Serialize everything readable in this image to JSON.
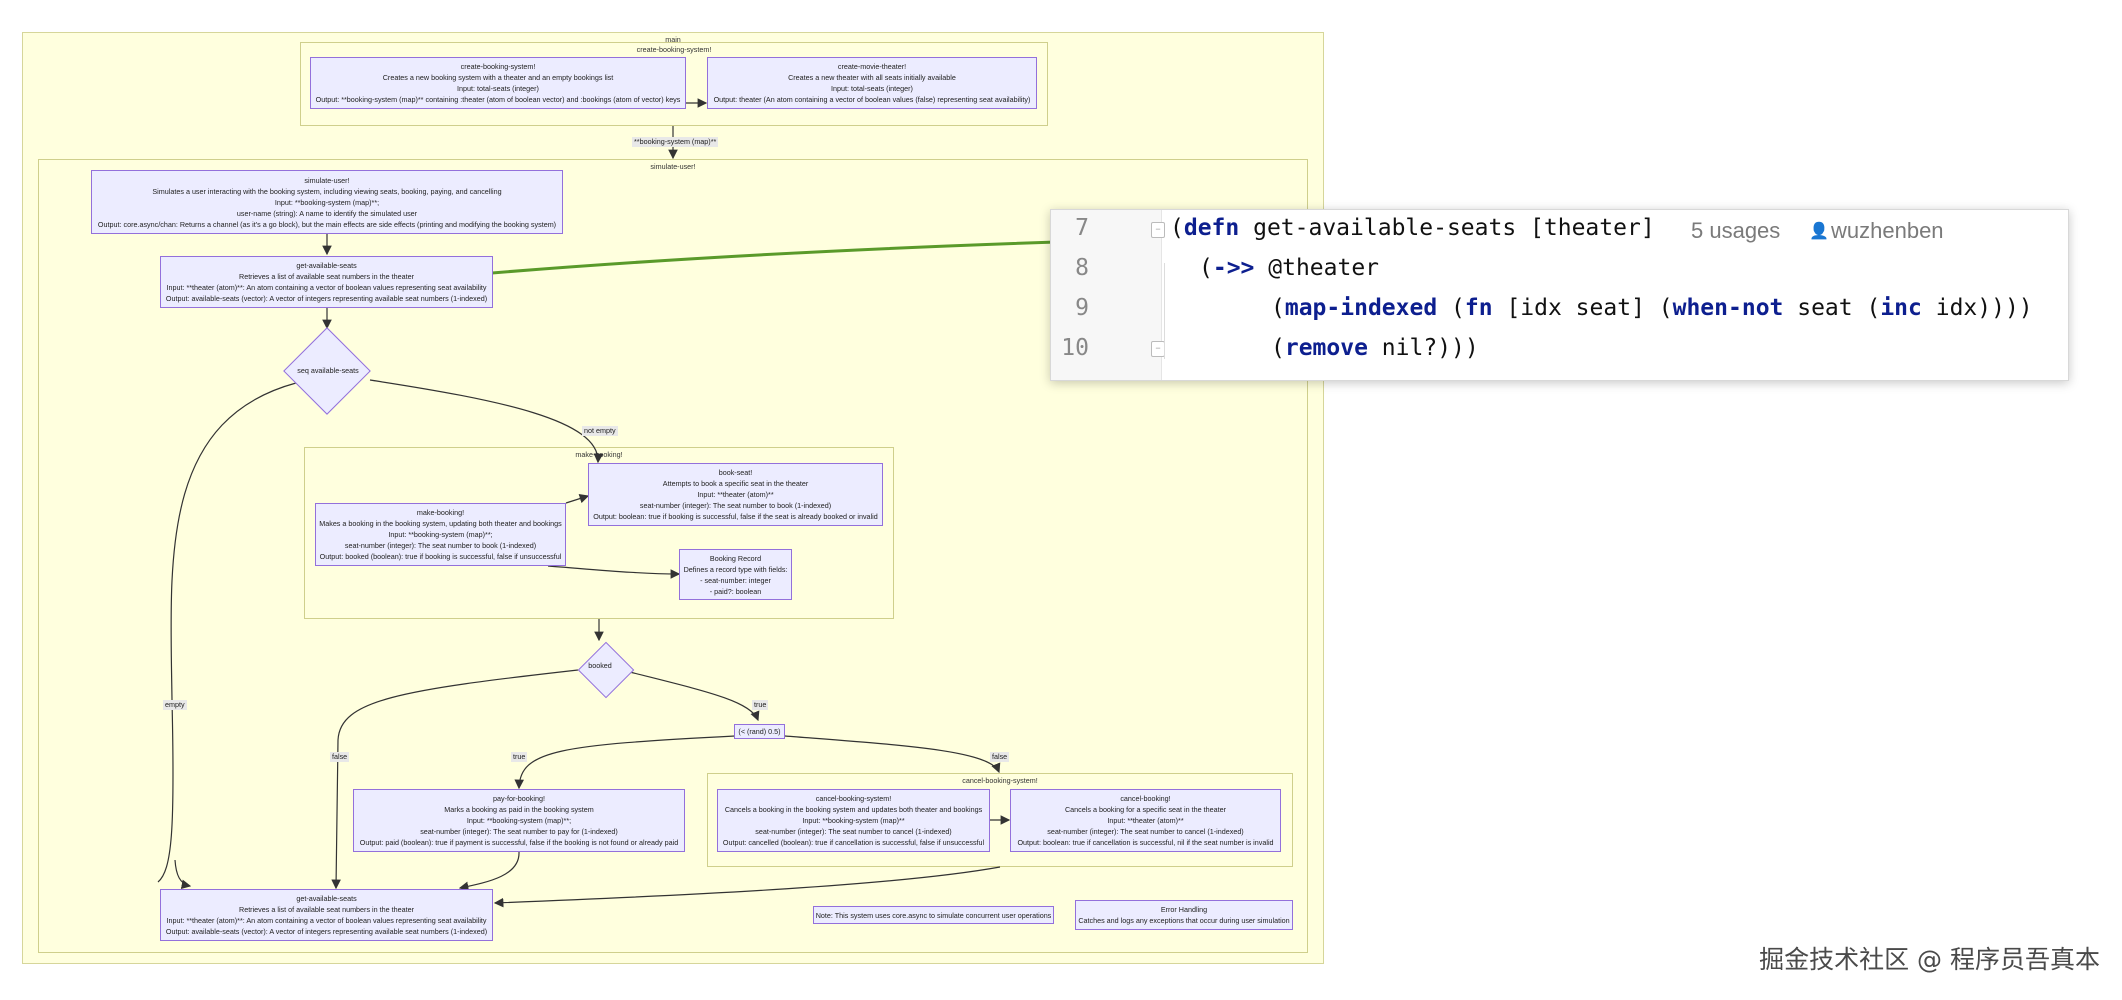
{
  "diagram": {
    "clusters": {
      "main": "main",
      "create_booking_system": "create-booking-system!",
      "simulate_user": "simulate-user!",
      "make_booking": "make-booking!",
      "cancel_booking_system": "cancel-booking-system!"
    },
    "nodes": {
      "create_booking_system": [
        "create-booking-system!",
        "Creates a new booking system with a theater and an empty bookings list",
        "Input: total-seats (integer)",
        "Output: **booking-system (map)** containing :theater (atom of boolean vector) and :bookings (atom of vector) keys"
      ],
      "create_movie_theater": [
        "create-movie-theater!",
        "Creates a new theater with all seats initially available",
        "Input: total-seats (integer)",
        "Output: theater (An atom containing a vector of boolean values (false) representing seat availability)"
      ],
      "simulate_user": [
        "simulate-user!",
        "Simulates a user interacting with the booking system, including viewing seats, booking, paying, and cancelling",
        "Input: **booking-system (map)**;",
        "user-name (string): A name to identify the simulated user",
        "Output: core.async/chan: Returns a channel (as it's a go block), but the main effects are side effects (printing and modifying the booking system)"
      ],
      "get_available_seats_top": [
        "get-available-seats",
        "Retrieves a list of available seat numbers in the theater",
        "Input: **theater (atom)**: An atom containing a vector of boolean values representing seat availability",
        "Output: available-seats (vector): A vector of integers representing available seat numbers (1-indexed)"
      ],
      "book_seat": [
        "book-seat!",
        "Attempts to book a specific seat in the theater",
        "Input: **theater (atom)**",
        "seat-number (integer): The seat number to book (1-indexed)",
        "Output: boolean: true if booking is successful, false if the seat is already booked or invalid"
      ],
      "make_booking": [
        "make-booking!",
        "Makes a booking in the booking system, updating both theater and bookings",
        "Input: **booking-system (map)**;",
        "seat-number (integer): The seat number to book (1-indexed)",
        "Output: booked (boolean): true if booking is successful, false if unsuccessful"
      ],
      "booking_record": [
        "Booking Record",
        "Defines a record type with fields:",
        "- seat-number: integer",
        "- paid?: boolean"
      ],
      "rand": [
        "(< (rand) 0.5)"
      ],
      "pay_for_booking": [
        "pay-for-booking!",
        "Marks a booking as paid in the booking system",
        "Input: **booking-system (map)**;",
        "seat-number (integer): The seat number to pay for (1-indexed)",
        "Output: paid (boolean): true if payment is successful, false if the booking is not found or already paid"
      ],
      "cancel_booking_system": [
        "cancel-booking-system!",
        "Cancels a booking in the booking system and updates both theater and bookings",
        "Input: **booking-system (map)**",
        "seat-number (integer): The seat number to cancel (1-indexed)",
        "Output: cancelled (boolean): true if cancellation is successful, false if unsuccessful"
      ],
      "cancel_booking": [
        "cancel-booking!",
        "Cancels a booking for a specific seat in the theater",
        "Input: **theater (atom)**",
        "seat-number (integer): The seat number to cancel (1-indexed)",
        "Output: boolean: true if cancellation is successful, nil if the seat number is invalid"
      ],
      "get_available_seats_bottom": [
        "get-available-seats",
        "Retrieves a list of available seat numbers in the theater",
        "Input: **theater (atom)**: An atom containing a vector of boolean values representing seat availability",
        "Output: available-seats (vector): A vector of integers representing available seat numbers (1-indexed)"
      ],
      "note": [
        "Note: This system uses core.async to simulate concurrent user operations"
      ],
      "error_handling": [
        "Error Handling",
        "Catches and logs any exceptions that occur during user simulation"
      ]
    },
    "decisions": {
      "seq_available": "seq available-seats",
      "booked": "booked"
    },
    "edge_labels": {
      "booking_system_map": "**booking-system (map)**",
      "not_empty": "not empty",
      "empty": "empty",
      "true_1": "true",
      "false_1": "false",
      "true_2": "true",
      "false_2": "false"
    }
  },
  "code": {
    "line_numbers": [
      "7",
      "8",
      "9",
      "10"
    ],
    "line7": {
      "open": "(",
      "kw": "defn",
      "rest": " get-available-seats [theater]"
    },
    "usages": "5 usages",
    "author": "wuzhenben",
    "line8": {
      "open": "(",
      "kw": "->>",
      "rest": " @theater"
    },
    "line9": {
      "open": "(",
      "kw1": "map-indexed",
      "mid1": " (",
      "kw2": "fn",
      "mid2": " [idx seat] (",
      "kw3": "when-not",
      "mid3": " seat (",
      "kw4": "inc",
      "rest": " idx))))"
    },
    "line10": {
      "open": "(",
      "kw": "remove",
      "rest": " nil?)))"
    }
  },
  "watermark": "掘金技术社区 @ 程序员吾真本",
  "colors": {
    "cluster_bg": "#ffffde",
    "node_bg": "#ececff",
    "node_border": "#9370db",
    "arrow": "#5a9a2a",
    "keyword": "#0d1f8f"
  }
}
